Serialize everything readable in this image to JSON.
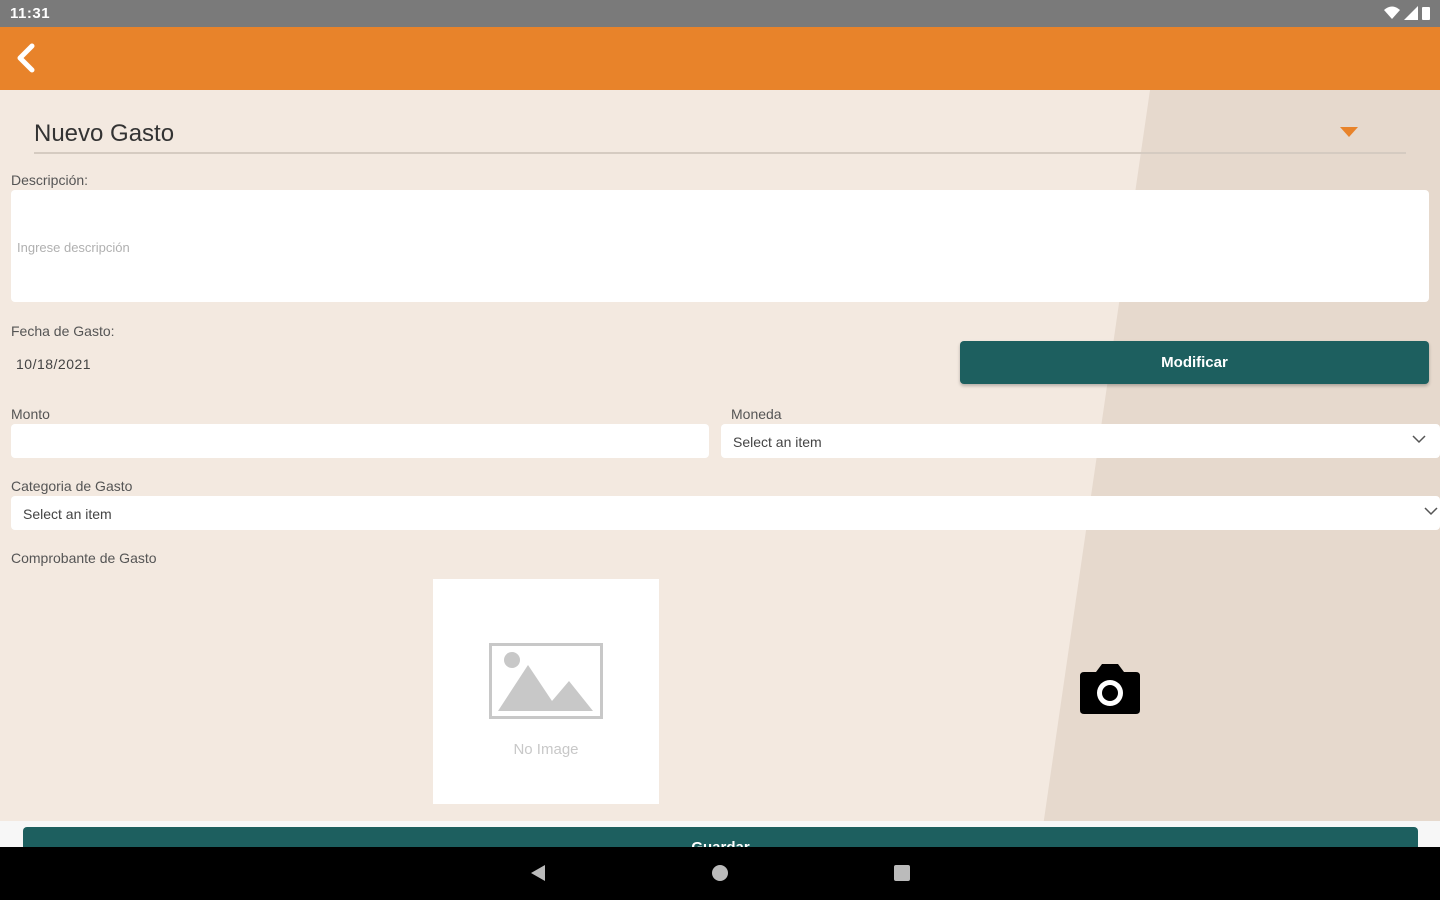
{
  "status_bar": {
    "time": "11:31"
  },
  "header": {
    "selected_type": "Nuevo Gasto"
  },
  "description": {
    "label": "Descripción:",
    "placeholder": "Ingrese descripción"
  },
  "date": {
    "label": "Fecha de Gasto:",
    "value": "10/18/2021",
    "modify_label": "Modificar"
  },
  "amount": {
    "label": "Monto",
    "value": ""
  },
  "currency": {
    "label": "Moneda",
    "selected": "Select an item"
  },
  "category": {
    "label": "Categoria de Gasto",
    "selected": "Select an item"
  },
  "receipt": {
    "label": "Comprobante de Gasto",
    "no_image_text": "No Image"
  },
  "save_button": {
    "label": "Guardar"
  },
  "colors": {
    "appbar": "#e8832a",
    "primary_button": "#1d5f5f",
    "background": "#f3e9e0"
  },
  "icons": [
    "back-arrow-icon",
    "dropdown-caret-icon",
    "chevron-down-icon",
    "image-placeholder-icon",
    "camera-icon",
    "wifi-icon",
    "signal-icon",
    "battery-icon",
    "nav-back-icon",
    "nav-home-icon",
    "nav-recents-icon"
  ]
}
